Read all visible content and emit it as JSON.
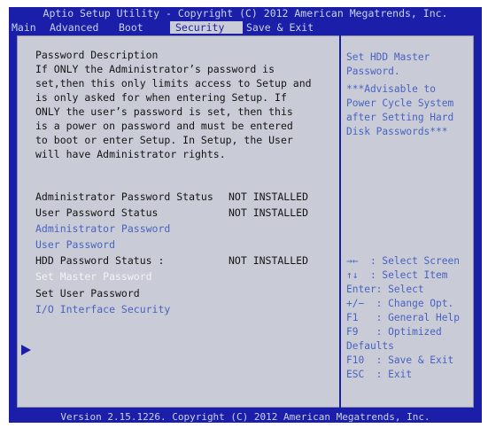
{
  "title": "Aptio Setup Utility - Copyright (C) 2012 American Megatrends, Inc.",
  "tabs": [
    "Main",
    "Advanced",
    "Boot",
    "Security",
    "Save & Exit"
  ],
  "active_tab": "Security",
  "description": {
    "heading": "Password Description",
    "lines": [
      "If ONLY the Administrator’s password is",
      "set,then this only limits access to Setup and",
      "is only asked for when entering Setup. If",
      "ONLY the user’s password is set, then this",
      "is a power on password and must be entered",
      "to boot or enter Setup. In Setup, the User",
      "will have Administrator rights."
    ]
  },
  "items": {
    "admin_status_label": "Administrator Password Status",
    "admin_status_value": "NOT INSTALLED",
    "user_status_label": "User Password Status",
    "user_status_value": "NOT INSTALLED",
    "admin_password": "Administrator Password",
    "user_password": "User Password",
    "hdd_status_label": "HDD Password Status :",
    "hdd_status_value": "NOT INSTALLED",
    "set_master_password": "Set Master Password",
    "set_user_password": "Set User Password",
    "io_interface_security": "I/O Interface Security"
  },
  "help_text": [
    "Set HDD Master",
    "Password.",
    "***Advisable to",
    "Power Cycle System",
    "after Setting Hard",
    "Disk Passwords***"
  ],
  "key_help": [
    "→←  : Select Screen",
    "↑↓  : Select Item",
    "Enter: Select",
    "+/−  : Change Opt.",
    "F1   : General Help",
    "F9   : Optimized",
    "Defaults",
    "F10  : Save & Exit",
    "ESC  : Exit"
  ],
  "footer": "Version 2.15.1226. Copyright (C) 2012 American Megatrends, Inc.",
  "colors": {
    "background_blue": "#1b1ea8",
    "panel_gray": "#c9ccd6",
    "link_blue": "#4a62c0",
    "header_text": "#c8d3ec"
  }
}
